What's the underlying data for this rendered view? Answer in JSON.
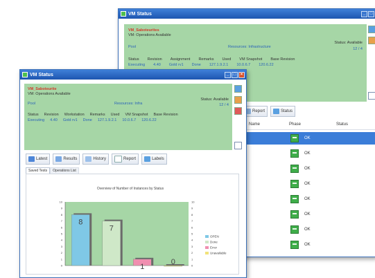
{
  "back_window": {
    "title": "VM Status",
    "vm_name": "VM_Saboteurites",
    "vm_sub": "VM: Operations Available",
    "addr_left": "Pool",
    "addr_mid": "Resources: Infrastructure",
    "addr_right": "Status: Available",
    "addr_right2": "12 / 4",
    "cols": [
      "Status",
      "Revision",
      "Assignment",
      "Remarks",
      "Used",
      "VM Snapshot",
      "Base Revision"
    ],
    "vals": [
      "Executing",
      "4.40",
      "Gold rv1",
      "Done",
      "127.1.9.2.1",
      "10.0.6.7",
      "120.6.22"
    ],
    "tabs": [
      "Report",
      "Status"
    ],
    "grid_headers": [
      "Name",
      "Phase",
      "Status"
    ],
    "rows": [
      "OK",
      "OK",
      "OK",
      "OK",
      "OK",
      "OK",
      "OK",
      "OK"
    ]
  },
  "front_window": {
    "title": "VM Status",
    "vm_name": "VM_Saboteurite",
    "vm_sub": "VM: Operations Available",
    "addr_left": "Pool",
    "addr_mid": "Resources: Infra",
    "addr_right": "Status: Available",
    "addr_right2": "12 / 4",
    "cols": [
      "Status",
      "Revision",
      "Workstation",
      "Remarks",
      "Used",
      "VM Snapshot",
      "Base Revision"
    ],
    "vals": [
      "Executing",
      "4.40",
      "Gold rv1",
      "Done",
      "127.1.9.2.1",
      "10.0.6.7",
      "120.6.22"
    ],
    "tabs": [
      "Latest",
      "Results",
      "History",
      "Report",
      "Labels"
    ],
    "subtabs": [
      "Saved Tests",
      "Operations List"
    ]
  },
  "chart_data": {
    "type": "bar",
    "title": "Overview of Number of Instances by Status",
    "categories": [
      "OPEN",
      "Done",
      "Error",
      "Unavailable"
    ],
    "values": [
      8,
      7,
      1,
      0
    ],
    "series_colors": [
      "#7fc8e6",
      "#cfe8c8",
      "#f08fb0",
      "#f2e27a"
    ],
    "ylim": [
      0,
      10
    ],
    "yticks": [
      "10",
      "9",
      "8",
      "7",
      "6",
      "5",
      "4",
      "3",
      "2",
      "1",
      "0"
    ],
    "legend_position": "right"
  },
  "colors": {
    "title_bar": "#2a64c2",
    "panel_green": "#a6d6a6",
    "vm_name_red": "#d23a2a"
  }
}
